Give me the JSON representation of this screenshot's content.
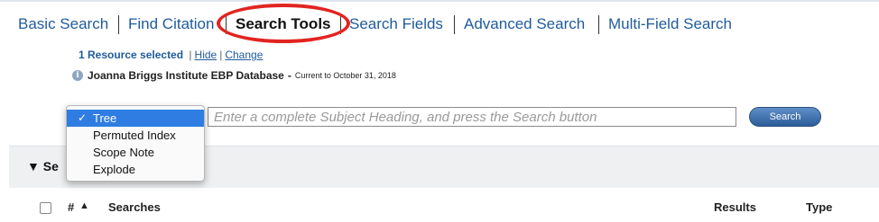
{
  "tabs": [
    {
      "label": "Basic Search"
    },
    {
      "label": "Find Citation"
    },
    {
      "label": "Search Tools"
    },
    {
      "label": "Search Fields"
    },
    {
      "label": "Advanced Search"
    },
    {
      "label": "Multi-Field Search"
    }
  ],
  "active_tab": "Search Tools",
  "resource": {
    "count_text": "1 Resource selected",
    "hide_label": "Hide",
    "change_label": "Change",
    "separator": "|",
    "database_name": "Joanna Briggs Institute EBP Database",
    "dash": "-",
    "currency_text": "Current to October 31, 2018"
  },
  "search": {
    "placeholder": "Enter a complete Subject Heading, and press the Search button",
    "button_label": "Search"
  },
  "dropdown": {
    "options": [
      "Tree",
      "Permuted Index",
      "Scope Note",
      "Explode"
    ],
    "selected": "Tree",
    "check_glyph": "✓"
  },
  "section": {
    "arrow": "▼",
    "title_partial": "Se"
  },
  "history_header": {
    "num_label": "#",
    "sort_glyph": "▲",
    "searches_label": "Searches",
    "results_label": "Results",
    "type_label": "Type"
  },
  "colors": {
    "link": "#1f5b9c",
    "highlight_ring": "#e22420",
    "selected_option": "#2f7de2"
  },
  "icons": {
    "info": "info-icon",
    "check": "check-icon",
    "collapse_arrow": "collapse-arrow-icon",
    "sort": "sort-ascending-icon"
  }
}
